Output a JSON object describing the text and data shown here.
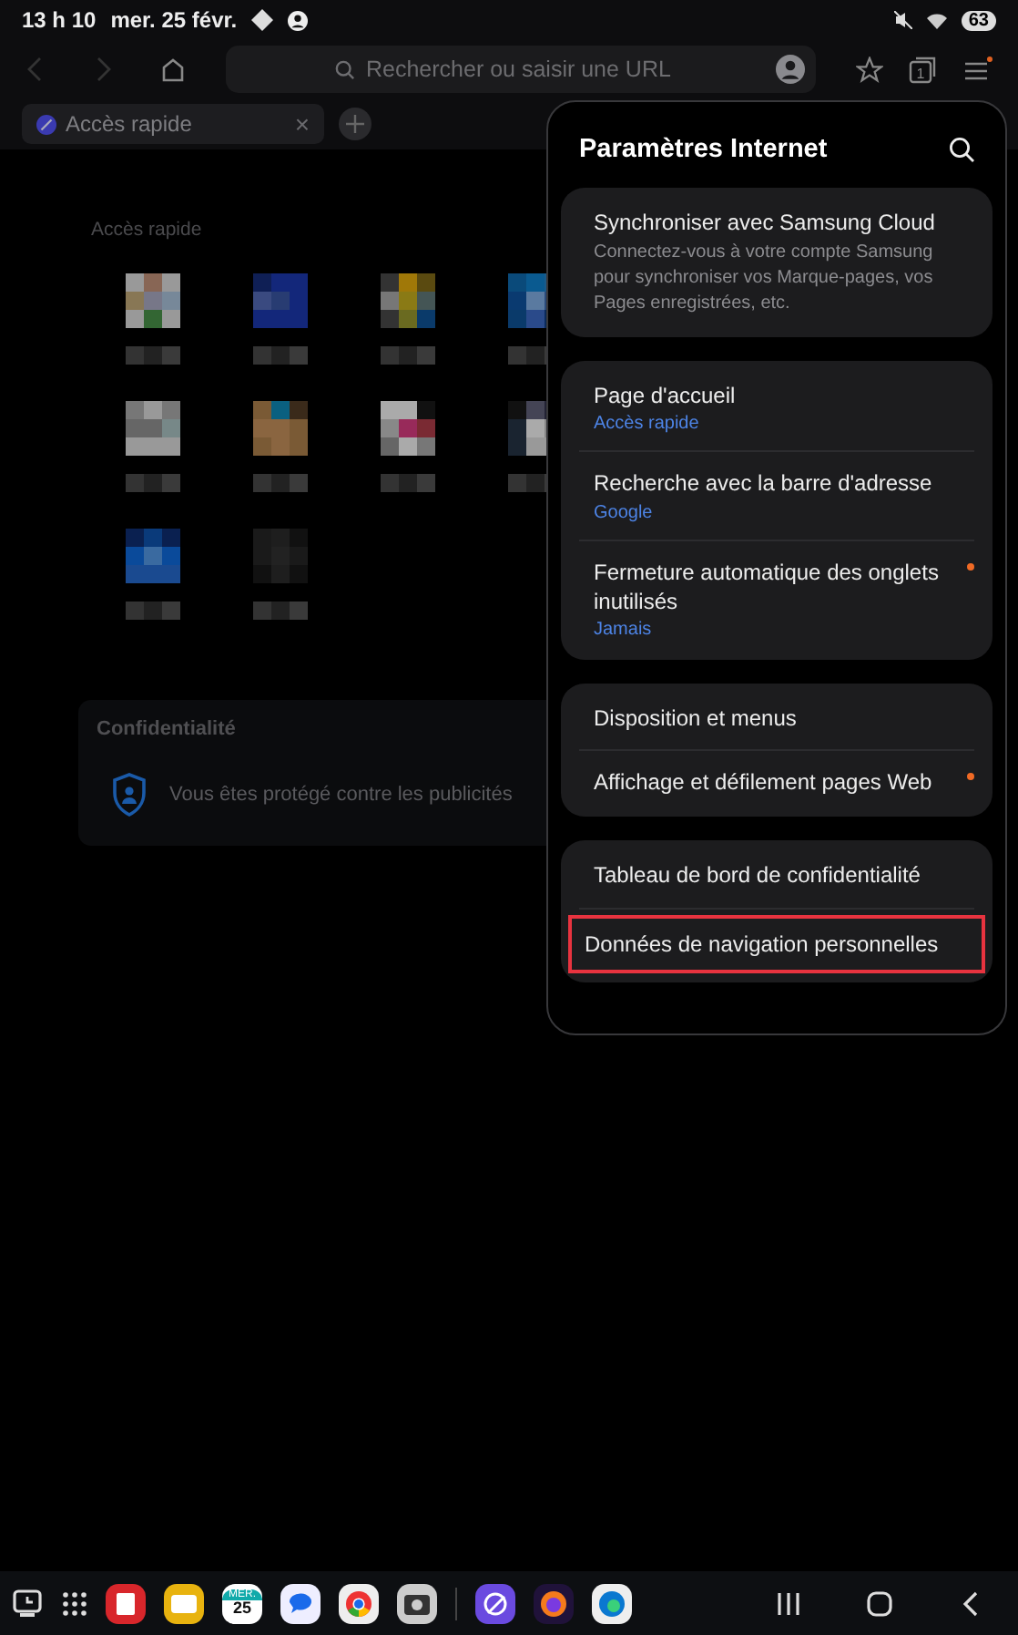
{
  "status_bar": {
    "time": "13 h 10",
    "date": "mer. 25 févr.",
    "battery": "63"
  },
  "toolbar": {
    "back_disabled": true,
    "forward_disabled": true,
    "url_placeholder": "Rechercher ou saisir une URL",
    "tab_count": "1",
    "menu_badge": true
  },
  "tabs": [
    {
      "label": "Accès rapide",
      "selected": true,
      "close": "×"
    }
  ],
  "page": {
    "quick_access_title": "Accès rapide",
    "privacy": {
      "title": "Confidentialité",
      "text": "Vous êtes protégé contre les publicités"
    }
  },
  "settings_panel": {
    "title": "Paramètres Internet",
    "groups": [
      {
        "items": [
          {
            "title": "Synchroniser avec Samsung Cloud",
            "description": "Connectez-vous à votre compte Samsung pour synchroniser vos Marque-pages, vos Pages enregistrées, etc.",
            "dot": false,
            "highlighted": false
          }
        ]
      },
      {
        "items": [
          {
            "title": "Page d'accueil",
            "value": "Accès rapide",
            "dot": false,
            "highlighted": false
          },
          {
            "title": "Recherche avec la barre d'adresse",
            "value": "Google",
            "dot": false,
            "highlighted": false
          },
          {
            "title": "Fermeture automatique des onglets inutilisés",
            "value": "Jamais",
            "dot": true,
            "highlighted": false
          }
        ]
      },
      {
        "items": [
          {
            "title": "Disposition et menus",
            "dot": false,
            "highlighted": false
          },
          {
            "title": "Affichage et défilement pages Web",
            "dot": true,
            "highlighted": false
          }
        ]
      },
      {
        "items": [
          {
            "title": "Tableau de bord de confidentialité",
            "dot": false,
            "highlighted": false
          },
          {
            "title": "Données de navigation personnelles",
            "dot": false,
            "highlighted": true
          }
        ]
      }
    ]
  },
  "taskbar": {
    "apps": [
      {
        "kind": "recent"
      },
      {
        "kind": "grid"
      },
      {
        "kind": "notes"
      },
      {
        "kind": "files"
      },
      {
        "kind": "calendar",
        "weekday": "MER.",
        "day": "25"
      },
      {
        "kind": "messages"
      },
      {
        "kind": "chrome"
      },
      {
        "kind": "camera"
      },
      {
        "kind": "divider"
      },
      {
        "kind": "internet"
      },
      {
        "kind": "firefox"
      },
      {
        "kind": "edge"
      }
    ],
    "nav": [
      {
        "kind": "recents"
      },
      {
        "kind": "home"
      },
      {
        "kind": "back"
      }
    ]
  }
}
